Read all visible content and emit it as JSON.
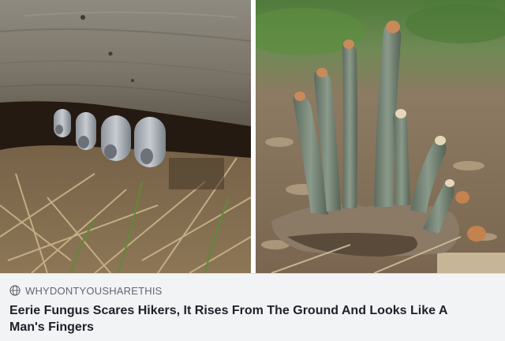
{
  "post": {
    "source_domain": "WHYDONTYOUSHARETHIS",
    "headline": "Eerie Fungus Scares Hikers, It Rises From The Ground And Looks Like A Man's Fingers"
  },
  "images": {
    "left": {
      "label": "fungus-under-log-photo"
    },
    "right": {
      "label": "fungus-fingers-in-soil-photo"
    }
  },
  "icons": {
    "source": "globe-icon"
  },
  "colors": {
    "caption_bg": "#f2f3f5",
    "headline": "#1d2129",
    "source": "#606770"
  }
}
